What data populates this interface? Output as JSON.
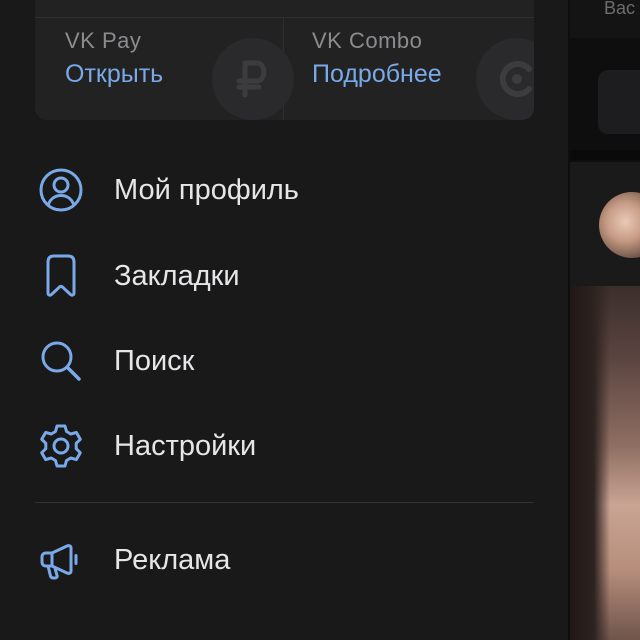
{
  "background_app": {
    "topbar_text": "Вас"
  },
  "pay": {
    "vkpay": {
      "title": "VK Pay",
      "action": "Открыть",
      "icon": "ruble-icon"
    },
    "combo": {
      "title": "VK Combo",
      "action": "Подробнее",
      "icon": "combo-icon"
    }
  },
  "menu": {
    "items": [
      {
        "label": "Мой профиль",
        "icon": "user-circle-icon"
      },
      {
        "label": "Закладки",
        "icon": "bookmark-icon"
      },
      {
        "label": "Поиск",
        "icon": "search-icon"
      },
      {
        "label": "Настройки",
        "icon": "gear-icon"
      }
    ],
    "ads": {
      "label": "Реклама",
      "icon": "megaphone-icon"
    }
  },
  "colors": {
    "accent": "#79a9e8",
    "drawer_bg": "#19191a",
    "card_bg": "#222223",
    "text": "#e6e6e8",
    "muted": "#8c8c8f"
  }
}
